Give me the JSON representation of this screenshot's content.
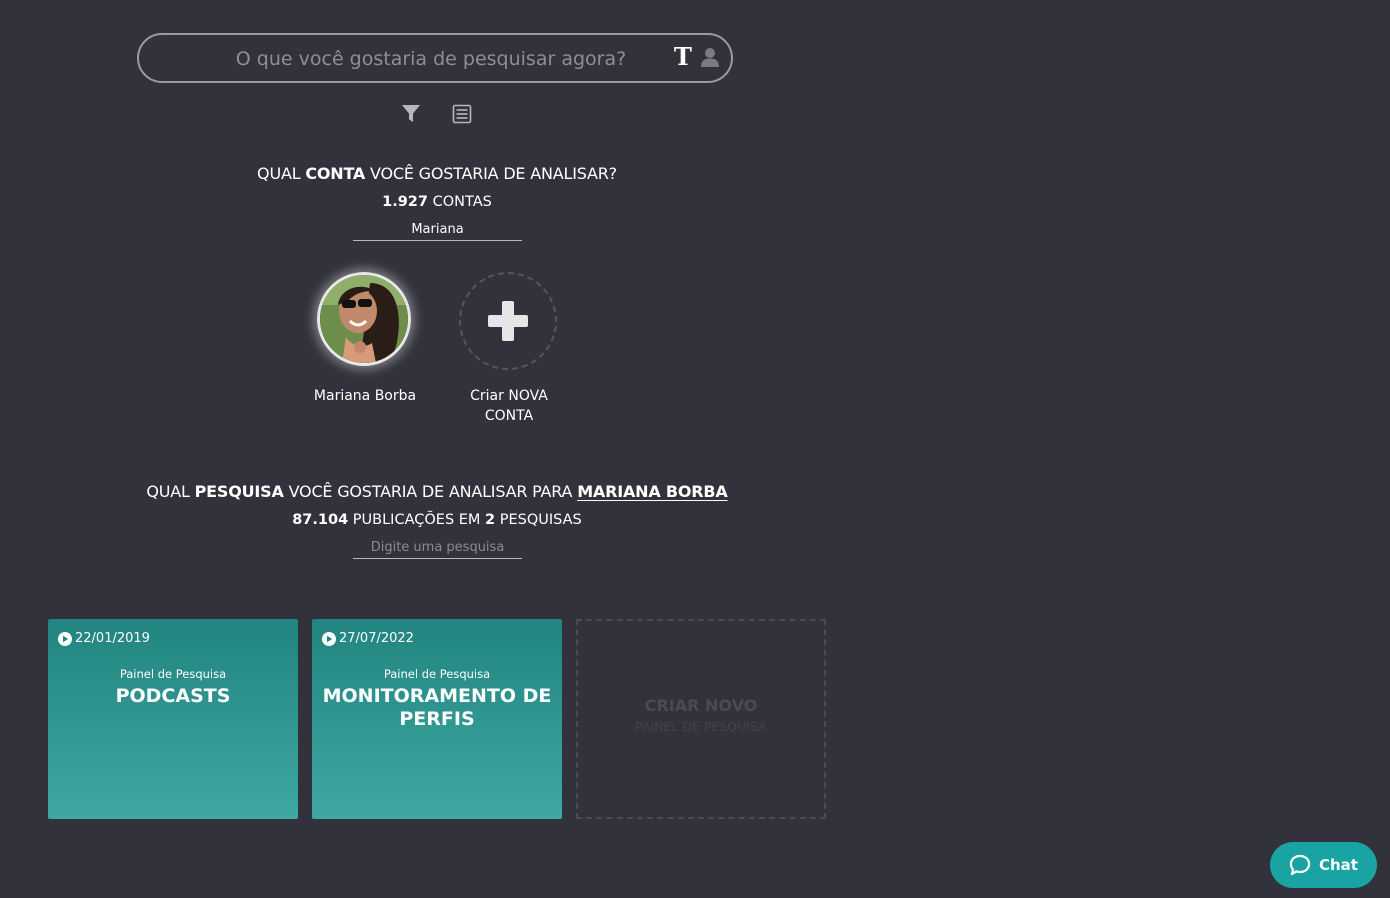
{
  "search": {
    "placeholder": "O que você gostaria de pesquisar agora?",
    "type_toggle": "T"
  },
  "account_section": {
    "heading_pre": "QUAL ",
    "heading_bold": "CONTA",
    "heading_post": " VOCÊ GOSTARIA DE ANALISAR?",
    "count_value": "1.927",
    "count_label": " CONTAS",
    "filter_value": "Mariana"
  },
  "accounts": [
    {
      "name": "Mariana Borba"
    }
  ],
  "new_account": {
    "line1": "Criar NOVA",
    "line2": "CONTA"
  },
  "research_section": {
    "heading_pre": "QUAL ",
    "heading_bold": "PESQUISA",
    "heading_mid": " VOCÊ GOSTARIA DE ANALISAR PARA ",
    "heading_link": "MARIANA BORBA",
    "count_value": "87.104",
    "count_mid": " PUBLICAÇÕES EM ",
    "count_searches": "2",
    "count_label": " PESQUISAS",
    "filter_placeholder": "Digite uma pesquisa"
  },
  "cards": [
    {
      "date": "22/01/2019",
      "kicker": "Painel de Pesquisa",
      "title": "PODCASTS"
    },
    {
      "date": "27/07/2022",
      "kicker": "Painel de Pesquisa",
      "title": "MONITORAMENTO DE PERFIS"
    }
  ],
  "new_card": {
    "title": "CRIAR NOVO",
    "subtitle": "PAINEL DE PESQUISA"
  },
  "chat": {
    "label": "Chat"
  },
  "colors": {
    "background": "#32323c",
    "card_top": "#21847f",
    "card_bottom": "#3fa8a2",
    "chat": "#1aa3a3"
  }
}
